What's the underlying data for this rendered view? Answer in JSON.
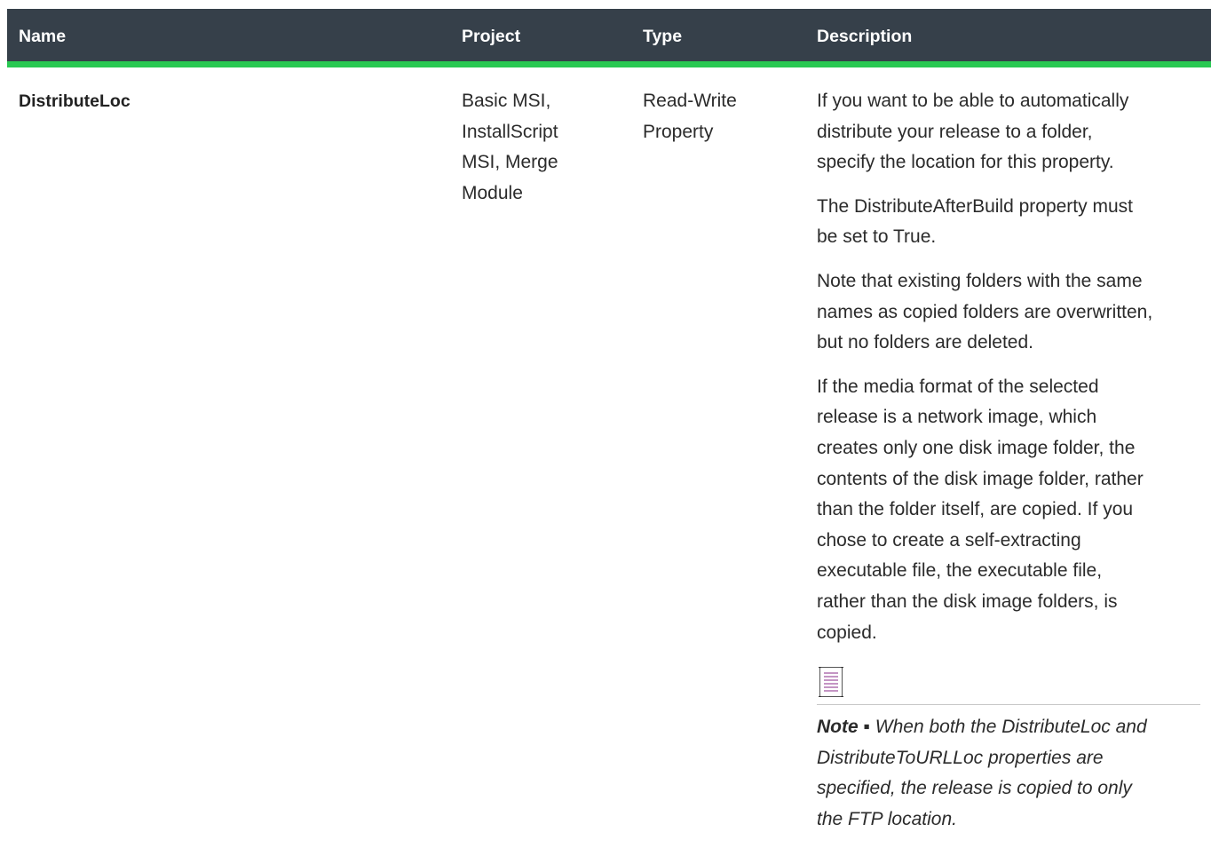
{
  "table": {
    "headers": {
      "name": "Name",
      "project": "Project",
      "type": "Type",
      "description": "Description"
    },
    "rows": [
      {
        "name": "DistributeLoc",
        "project_lines": [
          "Basic MSI,",
          "InstallScript",
          "MSI, Merge",
          "Module"
        ],
        "type_lines": [
          "Read-Write",
          "Property"
        ],
        "description": {
          "paragraphs": [
            [
              "If you want to be able to automatically",
              "distribute your release to a folder,",
              "specify the location for this property."
            ],
            [
              "The DistributeAfterBuild property must",
              "be set to True."
            ],
            [
              "Note that existing folders with the same",
              "names as copied folders are overwritten,",
              "but no folders are deleted."
            ],
            [
              "If the media format of the selected",
              "release is a network image, which",
              "creates only one disk image folder, the",
              "contents of the disk image folder, rather",
              "than the folder itself, are copied. If you",
              "chose to create a self-extracting",
              "executable file, the executable file,",
              "rather than the disk image folders, is",
              "copied."
            ]
          ],
          "note": {
            "icon": "note-icon",
            "label": "Note ▪",
            "lines": [
              " When both the DistributeLoc and",
              "DistributeToURLLoc properties are",
              "specified, the release is copied to only",
              "the FTP location."
            ]
          }
        }
      }
    ]
  },
  "colors": {
    "header_bg": "#36404a",
    "header_accent": "#28c852",
    "note_icon": "#8a2b8a"
  }
}
